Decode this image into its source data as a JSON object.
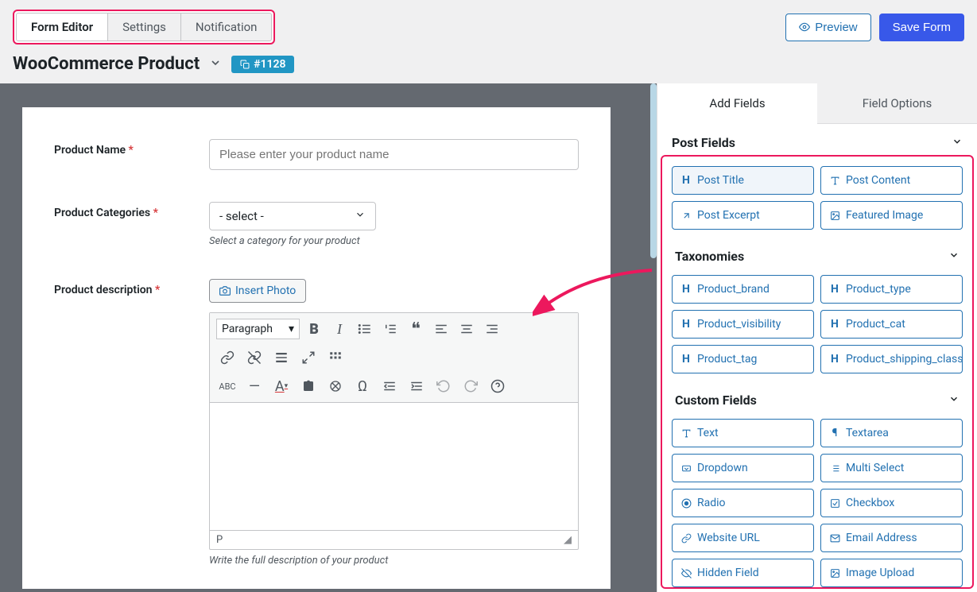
{
  "topTabs": {
    "editor": "Form Editor",
    "settings": "Settings",
    "notification": "Notification"
  },
  "actions": {
    "preview": "Preview",
    "save": "Save Form"
  },
  "title": {
    "name": "WooCommerce Product",
    "badge": "#1128"
  },
  "form": {
    "productName": {
      "label": "Product Name",
      "placeholder": "Please enter your product name"
    },
    "categories": {
      "label": "Product Categories",
      "selected": "- select -",
      "help": "Select a category for your product"
    },
    "description": {
      "label": "Product description",
      "insertPhoto": "Insert Photo",
      "paragraph": "Paragraph",
      "statusPath": "P",
      "help": "Write the full description of your product"
    }
  },
  "sidebar": {
    "tabs": {
      "add": "Add Fields",
      "options": "Field Options"
    },
    "postFields": {
      "title": "Post Fields",
      "items": [
        "Post Title",
        "Post Content",
        "Post Excerpt",
        "Featured Image"
      ]
    },
    "taxonomies": {
      "title": "Taxonomies",
      "items": [
        "Product_brand",
        "Product_type",
        "Product_visibility",
        "Product_cat",
        "Product_tag",
        "Product_shipping_class"
      ]
    },
    "customFields": {
      "title": "Custom Fields",
      "items": [
        "Text",
        "Textarea",
        "Dropdown",
        "Multi Select",
        "Radio",
        "Checkbox",
        "Website URL",
        "Email Address",
        "Hidden Field",
        "Image Upload"
      ]
    }
  }
}
